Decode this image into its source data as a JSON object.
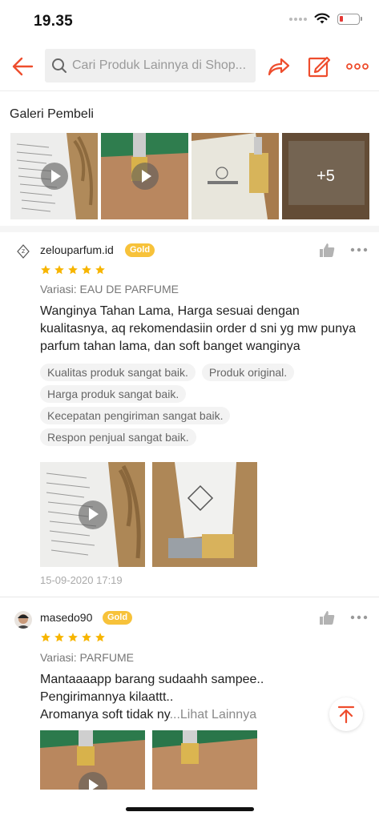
{
  "status_bar": {
    "time": "19.35",
    "battery_level": 0.2,
    "icons": [
      "cellular-dots-icon",
      "wifi-icon",
      "battery-icon"
    ]
  },
  "header": {
    "search_placeholder": "Cari Produk Lainnya di Shop...",
    "icons": [
      "back-arrow-icon",
      "search-icon",
      "share-icon",
      "edit-icon",
      "more-horizontal-icon"
    ]
  },
  "gallery": {
    "title": "Galeri Pembeli",
    "more_count": "+5"
  },
  "reviews": [
    {
      "username": "zelouparfum.id",
      "badge": "Gold",
      "rating": 5,
      "variation": "Variasi: EAU DE PARFUME",
      "text_lines": [
        "Wanginya Tahan Lama, Harga sesuai dengan",
        "kualitasnya, aq rekomendasiin order d sni yg mw punya",
        "parfum tahan lama, dan soft banget wanginya"
      ],
      "tags": [
        "Kualitas produk sangat baik.",
        "Produk original.",
        "Harga produk sangat baik.",
        "Kecepatan pengiriman sangat baik.",
        "Respon penjual sangat baik."
      ],
      "date": "15-09-2020 17:19"
    },
    {
      "username": "masedo90",
      "badge": "Gold",
      "rating": 5,
      "variation": "Variasi: PARFUME",
      "text_lines": [
        "Mantaaaapp barang sudaahh sampee..",
        "Pengirimannya kilaattt..",
        "Aromanya soft tidak ny"
      ],
      "see_more": "...Lihat Lainnya"
    }
  ],
  "colors": {
    "brand": "#ee4d2d",
    "badge_gold": "#f7c23a",
    "star": "#f7b500"
  }
}
